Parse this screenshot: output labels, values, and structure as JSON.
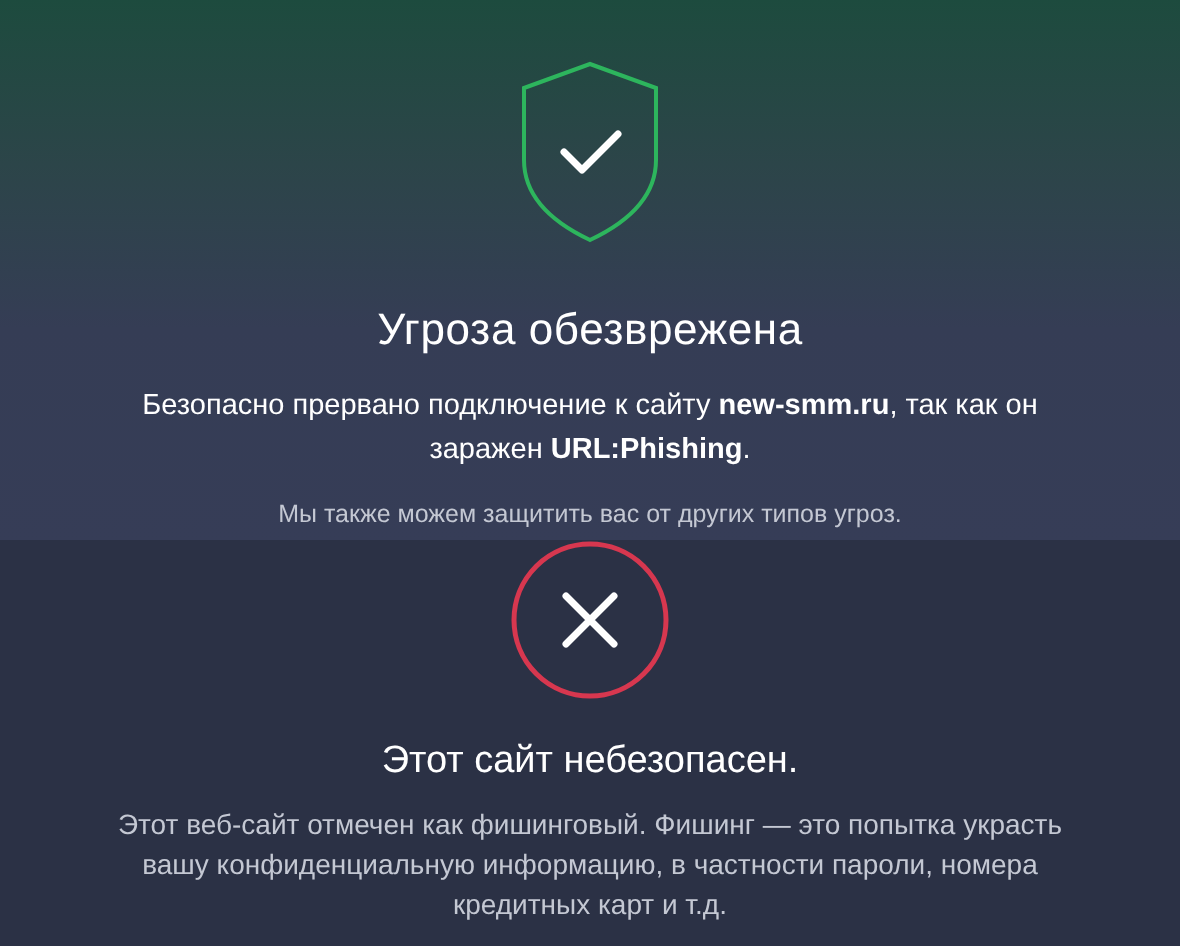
{
  "threat": {
    "title": "Угроза обезврежена",
    "message": "Безопасно прервано подключение к сайту **new-smm.ru**, так как он заражен **URL:Phishing**.",
    "note": "Мы также можем защитить вас от других типов угроз."
  },
  "warning": {
    "title": "Этот сайт небезопасен.",
    "message": "Этот веб-сайт отмечен как фишинговый. Фишинг — это попытка украсть вашу конфиденциальную информацию, в частности пароли, номера кредитных карт и т.д."
  }
}
